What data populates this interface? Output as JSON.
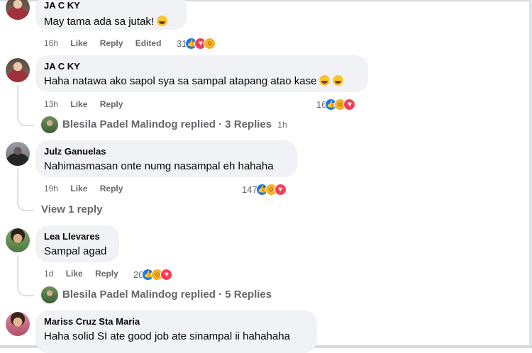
{
  "comments": [
    {
      "author": "JA C KY",
      "text": "May tama ada sa jutak!",
      "time": "16h",
      "like": "Like",
      "reply": "Reply",
      "edited": "Edited",
      "reaction_count": "31",
      "reactions": [
        "like-icon",
        "heart-icon",
        "haha-icon"
      ]
    },
    {
      "author": "JA C KY",
      "text": "Haha natawa ako sapol sya sa sampal atapang atao kase",
      "time": "13h",
      "like": "Like",
      "reply": "Reply",
      "reaction_count": "16",
      "reactions": [
        "like-icon",
        "haha-icon",
        "heart-icon"
      ],
      "replies": {
        "author": "Blesila Padel Malindog",
        "text": "replied · 3 Replies",
        "time": "1h"
      }
    },
    {
      "author": "Julz Ganuelas",
      "text": "Nahimasmasan onte numg nasampal eh hahaha",
      "time": "19h",
      "like": "Like",
      "reply": "Reply",
      "reaction_count": "147",
      "reactions": [
        "like-icon",
        "haha-icon",
        "heart-icon"
      ],
      "view_replies": "View 1 reply"
    },
    {
      "author": "Lea Llevares",
      "text": "Sampal agad",
      "time": "1d",
      "like": "Like",
      "reply": "Reply",
      "reaction_count": "20",
      "reactions": [
        "like-icon",
        "haha-icon",
        "heart-icon"
      ],
      "replies": {
        "author": "Blesila Padel Malindog",
        "text": "replied · 5 Replies"
      }
    },
    {
      "author": "Mariss Cruz Sta Maria",
      "text": "Haha solid SI ate good job ate sinampal ii hahahaha"
    }
  ],
  "colors": {
    "bubble_bg": "#f0f2f5",
    "meta_text": "#65676b",
    "like_blue": "#1877f2",
    "heart_red": "#f33e58",
    "haha_yellow": "#f7b125"
  }
}
